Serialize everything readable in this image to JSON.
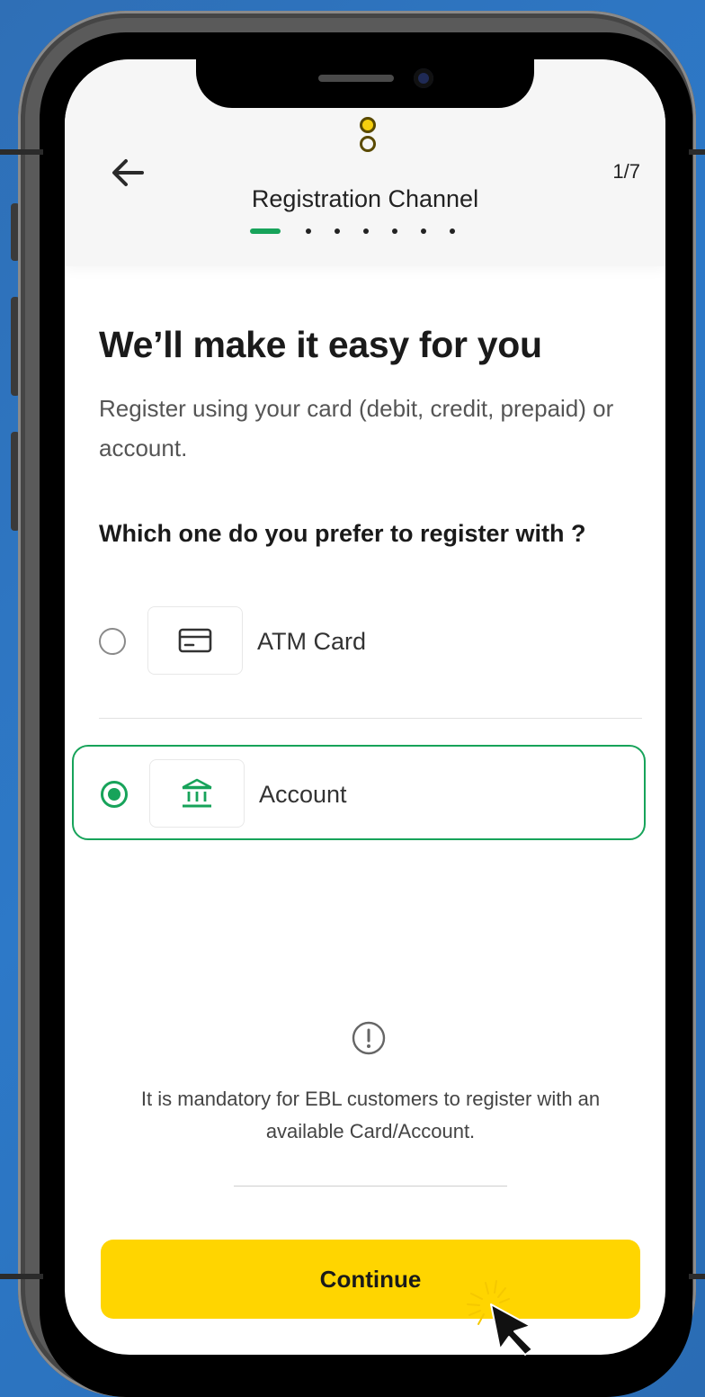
{
  "header": {
    "title": "Registration Channel",
    "step_counter": "1/7",
    "total_steps": 7,
    "current_step": 1
  },
  "main": {
    "heading": "We’ll make it easy for you",
    "description": "Register using your card (debit, credit, prepaid) or account.",
    "question": "Which one do you prefer to register with ?",
    "options": [
      {
        "label": "ATM Card",
        "icon": "credit-card-icon",
        "selected": false
      },
      {
        "label": "Account",
        "icon": "bank-icon",
        "selected": true
      }
    ],
    "notice": "It is mandatory for EBL customers to register with an available Card/Account."
  },
  "footer": {
    "continue_label": "Continue"
  },
  "colors": {
    "accent_green": "#17a35a",
    "button_yellow": "#ffd500",
    "background_blue": "#2d79c8"
  }
}
